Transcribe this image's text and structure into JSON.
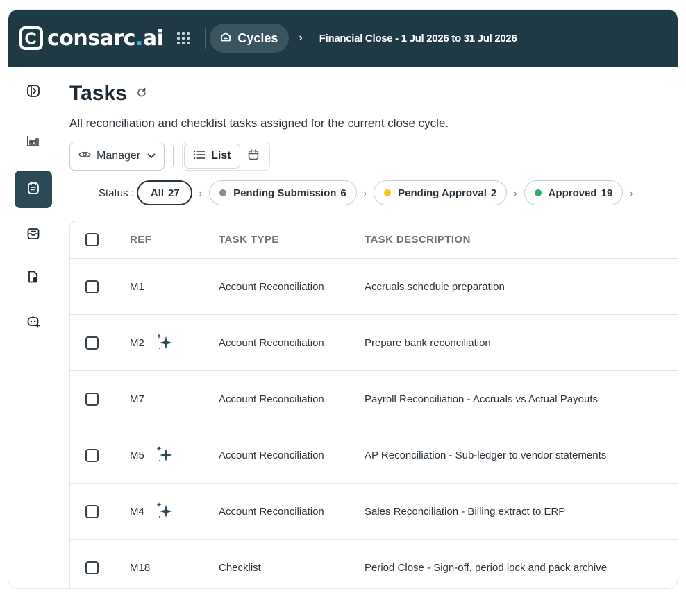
{
  "app": {
    "logo_prefix": "consarc",
    "logo_dot": ".",
    "logo_suffix": "ai",
    "brand_color": "#203a45",
    "accent_color": "#34b3e4"
  },
  "breadcrumb": {
    "cycles_label": "Cycles",
    "current": "Financial Close - 1 Jul 2026 to 31 Jul 2026"
  },
  "sidebar": {
    "items": [
      {
        "name": "toggle-sidebar",
        "icon": "sidebar-toggle-icon"
      },
      {
        "name": "dashboard",
        "icon": "bar-chart-icon"
      },
      {
        "name": "tasks",
        "icon": "task-list-icon",
        "active": true
      },
      {
        "name": "inbox",
        "icon": "inbox-icon"
      },
      {
        "name": "documents",
        "icon": "document-icon"
      },
      {
        "name": "assistant",
        "icon": "bot-icon"
      }
    ]
  },
  "page": {
    "title": "Tasks",
    "subtitle": "All reconciliation and checklist tasks assigned for the current close cycle."
  },
  "toolbar": {
    "role_label": "Manager",
    "list_label": "List"
  },
  "status_filter": {
    "label": "Status :",
    "pills": [
      {
        "label": "All",
        "count": "27",
        "dot": "",
        "active": true
      },
      {
        "label": "Pending Submission",
        "count": "6",
        "dot": "#8a8f94"
      },
      {
        "label": "Pending Approval",
        "count": "2",
        "dot": "#f5c518"
      },
      {
        "label": "Approved",
        "count": "19",
        "dot": "#2eae5f"
      }
    ]
  },
  "table": {
    "columns": [
      "REF",
      "TASK TYPE",
      "TASK DESCRIPTION"
    ],
    "rows": [
      {
        "ref": "M1",
        "ai": false,
        "type": "Account Reconciliation",
        "description": "Accruals schedule preparation"
      },
      {
        "ref": "M2",
        "ai": true,
        "type": "Account Reconciliation",
        "description": "Prepare bank reconciliation"
      },
      {
        "ref": "M7",
        "ai": false,
        "type": "Account Reconciliation",
        "description": "Payroll Reconciliation - Accruals vs Actual Payouts"
      },
      {
        "ref": "M5",
        "ai": true,
        "type": "Account Reconciliation",
        "description": "AP Reconciliation - Sub-ledger to vendor statements"
      },
      {
        "ref": "M4",
        "ai": true,
        "type": "Account Reconciliation",
        "description": "Sales Reconciliation - Billing extract to ERP"
      },
      {
        "ref": "M18",
        "ai": false,
        "type": "Checklist",
        "description": "Period Close - Sign-off, period lock and pack archive"
      }
    ]
  }
}
